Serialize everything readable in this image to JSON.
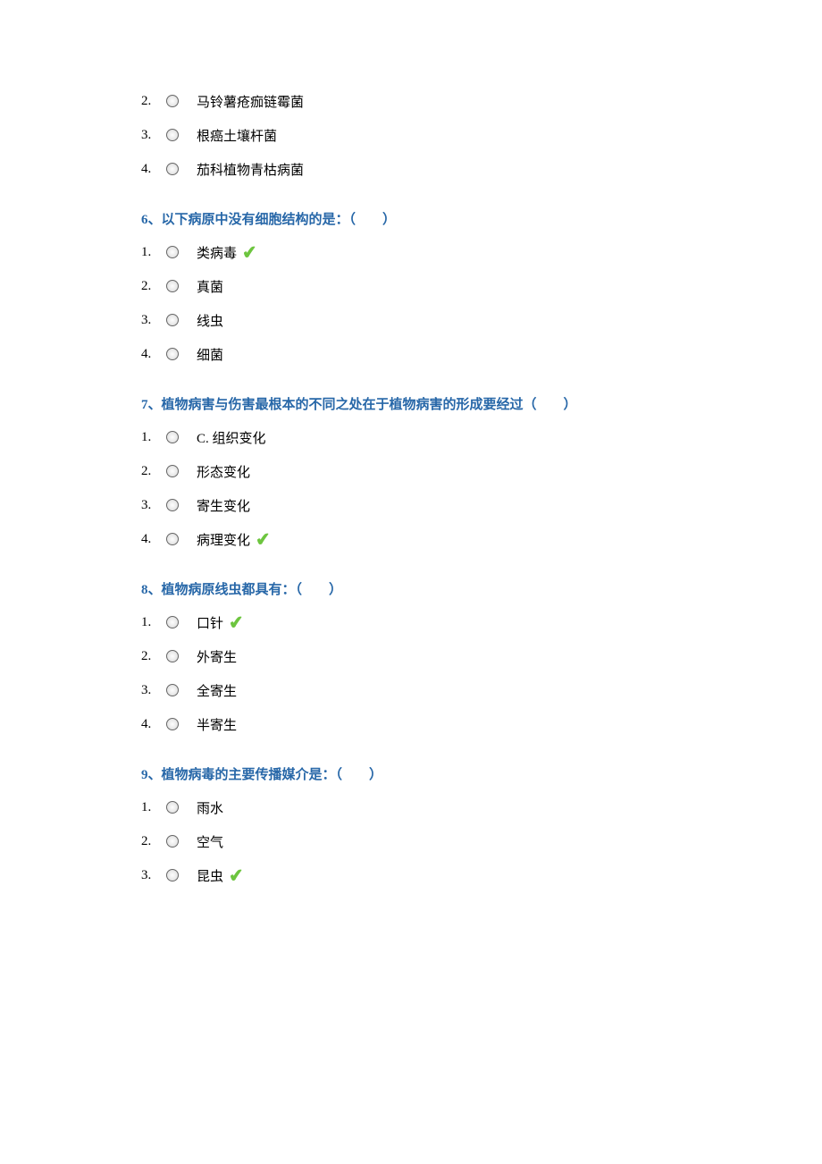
{
  "partial_group": {
    "options": [
      {
        "num": "2.",
        "text": "马铃薯疮痂链霉菌",
        "correct": false
      },
      {
        "num": "3.",
        "text": "根癌土壤杆菌",
        "correct": false
      },
      {
        "num": "4.",
        "text": "茄科植物青枯病菌",
        "correct": false
      }
    ]
  },
  "questions": [
    {
      "title": "6、以下病原中没有细胞结构的是：（　　）",
      "options": [
        {
          "num": "1.",
          "text": "类病毒",
          "correct": true
        },
        {
          "num": "2.",
          "text": "真菌",
          "correct": false
        },
        {
          "num": "3.",
          "text": "线虫",
          "correct": false
        },
        {
          "num": "4.",
          "text": "细菌",
          "correct": false
        }
      ]
    },
    {
      "title": "7、植物病害与伤害最根本的不同之处在于植物病害的形成要经过（　　）",
      "options": [
        {
          "num": "1.",
          "text": "C. 组织变化",
          "correct": false
        },
        {
          "num": "2.",
          "text": "形态变化",
          "correct": false
        },
        {
          "num": "3.",
          "text": "寄生变化",
          "correct": false
        },
        {
          "num": "4.",
          "text": "病理变化",
          "correct": true
        }
      ]
    },
    {
      "title": "8、植物病原线虫都具有：（　　）",
      "options": [
        {
          "num": "1.",
          "text": "口针",
          "correct": true
        },
        {
          "num": "2.",
          "text": "外寄生",
          "correct": false
        },
        {
          "num": "3.",
          "text": "全寄生",
          "correct": false
        },
        {
          "num": "4.",
          "text": "半寄生",
          "correct": false
        }
      ]
    },
    {
      "title": "9、植物病毒的主要传播媒介是：（　　）",
      "options": [
        {
          "num": "1.",
          "text": "雨水",
          "correct": false
        },
        {
          "num": "2.",
          "text": "空气",
          "correct": false
        },
        {
          "num": "3.",
          "text": "昆虫",
          "correct": true
        }
      ]
    }
  ]
}
